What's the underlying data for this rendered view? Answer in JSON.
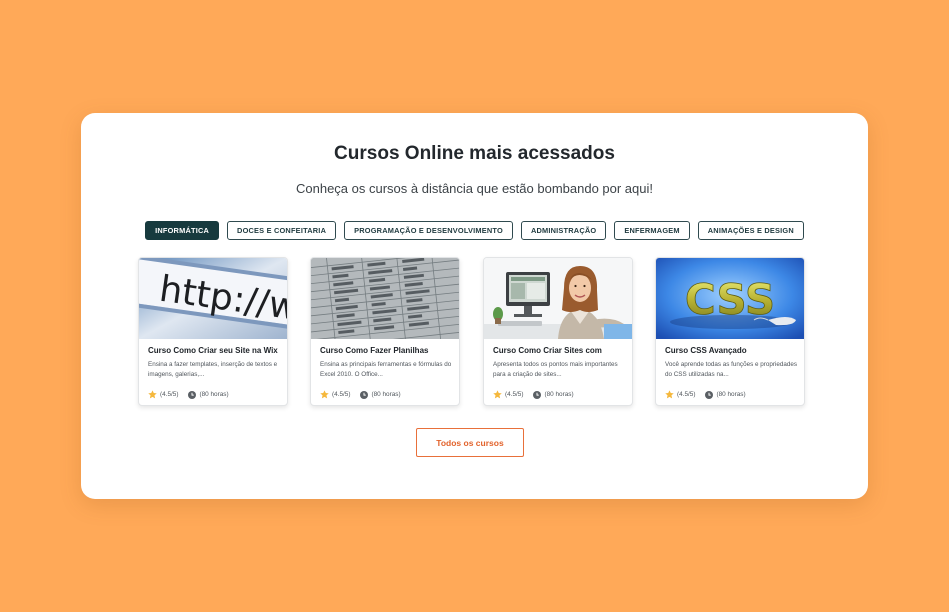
{
  "section": {
    "title": "Cursos Online mais acessados",
    "subtitle": "Conheça os cursos à distância que estão bombando por aqui!"
  },
  "tabs": [
    {
      "label": "INFORMÁTICA",
      "active": true
    },
    {
      "label": "DOCES E CONFEITARIA",
      "active": false
    },
    {
      "label": "PROGRAMAÇÃO E DESENVOLVIMENTO",
      "active": false
    },
    {
      "label": "ADMINISTRAÇÃO",
      "active": false
    },
    {
      "label": "ENFERMAGEM",
      "active": false
    },
    {
      "label": "ANIMAÇÕES E DESIGN",
      "active": false
    }
  ],
  "courses": [
    {
      "title": "Curso Como Criar seu Site na Wix",
      "description": "Ensina a fazer templates, inserção de textos e imagens, galerias,...",
      "rating": "(4.5/5)",
      "duration": "(80 horas)",
      "image_icon": "http-browser-image"
    },
    {
      "title": "Curso Como Fazer Planilhas",
      "description": "Ensina as principais ferramentas e fórmulas do Excel 2010. O Office...",
      "rating": "(4.5/5)",
      "duration": "(80 horas)",
      "image_icon": "spreadsheet-image"
    },
    {
      "title": "Curso Como Criar Sites com",
      "description": "Apresenta todos os pontos mais importantes para a criação de sites...",
      "rating": "(4.5/5)",
      "duration": "(80 horas)",
      "image_icon": "woman-computer-image"
    },
    {
      "title": "Curso CSS Avançado",
      "description": "Você aprende todas as funções e propriedades do CSS utilizadas na...",
      "rating": "(4.5/5)",
      "duration": "(80 horas)",
      "image_icon": "css-text-image"
    }
  ],
  "all_courses_label": "Todos os cursos",
  "colors": {
    "background": "#FFA958",
    "active_tab": "#173a3e",
    "accent": "#e2622b",
    "star": "#f5b83d"
  }
}
